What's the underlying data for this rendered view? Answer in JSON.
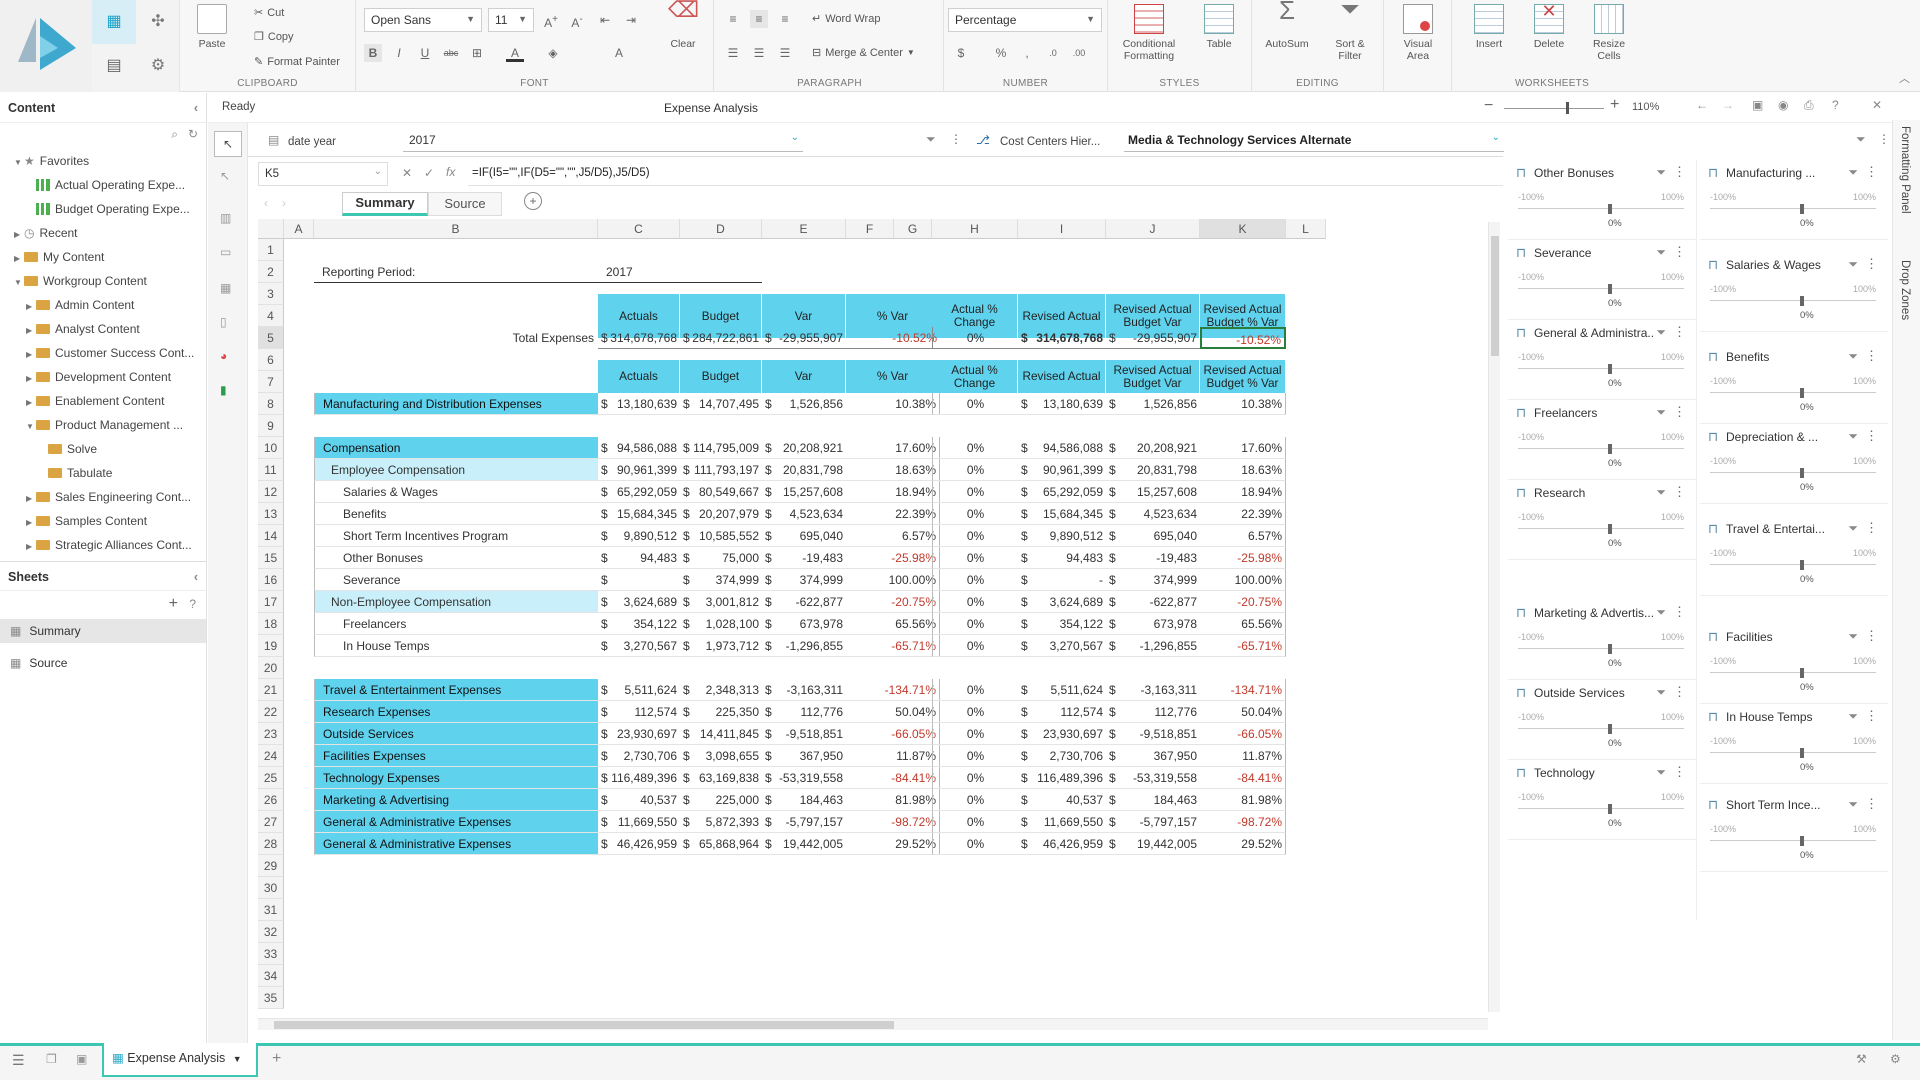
{
  "ribbon": {
    "clipboard": {
      "label": "CLIPBOARD",
      "paste": "Paste",
      "cut": "Cut",
      "copy": "Copy",
      "format_painter": "Format Painter"
    },
    "font": {
      "label": "FONT",
      "family": "Open Sans",
      "size": "11"
    },
    "paragraph": {
      "label": "PARAGRAPH",
      "word_wrap": "Word Wrap",
      "merge_center": "Merge & Center"
    },
    "clear": "Clear",
    "number": {
      "label": "NUMBER",
      "format": "Percentage"
    },
    "styles": {
      "label": "STYLES",
      "conditional": "Conditional\nFormatting",
      "table": "Table"
    },
    "editing": {
      "label": "EDITING",
      "autosum": "AutoSum",
      "sort_filter": "Sort &\nFilter"
    },
    "visual_area": "Visual\nArea",
    "worksheets": {
      "label": "WORKSHEETS",
      "insert": "Insert",
      "delete": "Delete",
      "resize": "Resize\nCells"
    }
  },
  "content_panel": {
    "title": "Content",
    "tree": [
      {
        "label": "Favorites",
        "level": 0,
        "icon": "star"
      },
      {
        "label": "Actual Operating Expe...",
        "level": 1,
        "icon": "chart"
      },
      {
        "label": "Budget Operating Expe...",
        "level": 1,
        "icon": "chart"
      },
      {
        "label": "Recent",
        "level": 0,
        "icon": "clock"
      },
      {
        "label": "My Content",
        "level": 0,
        "icon": "folder"
      },
      {
        "label": "Workgroup Content",
        "level": 0,
        "icon": "folder"
      },
      {
        "label": "Admin Content",
        "level": 1,
        "icon": "folder"
      },
      {
        "label": "Analyst Content",
        "level": 1,
        "icon": "folder"
      },
      {
        "label": "Customer Success Cont...",
        "level": 1,
        "icon": "folder"
      },
      {
        "label": "Development Content",
        "level": 1,
        "icon": "folder"
      },
      {
        "label": "Enablement Content",
        "level": 1,
        "icon": "folder"
      },
      {
        "label": "Product Management ...",
        "level": 1,
        "icon": "folder"
      },
      {
        "label": "Solve",
        "level": 2,
        "icon": "folder"
      },
      {
        "label": "Tabulate",
        "level": 2,
        "icon": "folder"
      },
      {
        "label": "Sales Engineering Cont...",
        "level": 1,
        "icon": "folder"
      },
      {
        "label": "Samples Content",
        "level": 1,
        "icon": "folder"
      },
      {
        "label": "Strategic Alliances Cont...",
        "level": 1,
        "icon": "folder"
      }
    ]
  },
  "sheets_panel": {
    "title": "Sheets",
    "items": [
      "Summary",
      "Source"
    ]
  },
  "status": "Ready",
  "doc_title": "Expense Analysis",
  "zoom": "110%",
  "filters": {
    "date_label": "date year",
    "date_value": "2017",
    "cc_label": "Cost Centers Hier...",
    "cc_value": "Media & Technology Services Alternate"
  },
  "formula": {
    "cell": "K5",
    "text": "=IF(I5=\"\",IF(D5=\"\",\"\",J5/D5),J5/D5)"
  },
  "tabs": [
    "Summary",
    "Source"
  ],
  "columns": [
    "A",
    "B",
    "C",
    "D",
    "E",
    "F",
    "G",
    "H",
    "I",
    "J",
    "K",
    "L"
  ],
  "grid": {
    "reporting_label": "Reporting Period:",
    "reporting_value": "2017",
    "headers_left": [
      "Actuals",
      "Budget",
      "Var",
      "% Var"
    ],
    "headers_right": [
      "Actual % Change",
      "Revised Actual",
      "Revised Actual Budget Var",
      "Revised Actual Budget % Var"
    ],
    "total": {
      "label": "Total Expenses",
      "c": "314,678,768",
      "d": "284,722,861",
      "e": "-29,955,907",
      "f": "-10.52%",
      "h": "0%",
      "i": "314,678,768",
      "j": "-29,955,907",
      "k": "-10.52%"
    },
    "rows": [
      {
        "r": 8,
        "label": "Manufacturing and Distribution Expenses",
        "style": "hl",
        "c": "13,180,639",
        "d": "14,707,495",
        "e": "1,526,856",
        "f": "10.38%",
        "h": "0%",
        "i": "13,180,639",
        "j": "1,526,856",
        "k": "10.38%"
      },
      {
        "r": 10,
        "label": "Compensation",
        "style": "hl",
        "c": "94,586,088",
        "d": "114,795,009",
        "e": "20,208,921",
        "f": "17.60%",
        "h": "0%",
        "i": "94,586,088",
        "j": "20,208,921",
        "k": "17.60%"
      },
      {
        "r": 11,
        "label": "Employee Compensation",
        "style": "hl2",
        "c": "90,961,399",
        "d": "111,793,197",
        "e": "20,831,798",
        "f": "18.63%",
        "h": "0%",
        "i": "90,961,399",
        "j": "20,831,798",
        "k": "18.63%"
      },
      {
        "r": 12,
        "label": "Salaries & Wages",
        "style": "sub",
        "c": "65,292,059",
        "d": "80,549,667",
        "e": "15,257,608",
        "f": "18.94%",
        "h": "0%",
        "i": "65,292,059",
        "j": "15,257,608",
        "k": "18.94%"
      },
      {
        "r": 13,
        "label": "Benefits",
        "style": "sub",
        "c": "15,684,345",
        "d": "20,207,979",
        "e": "4,523,634",
        "f": "22.39%",
        "h": "0%",
        "i": "15,684,345",
        "j": "4,523,634",
        "k": "22.39%"
      },
      {
        "r": 14,
        "label": "Short Term Incentives Program",
        "style": "sub",
        "c": "9,890,512",
        "d": "10,585,552",
        "e": "695,040",
        "f": "6.57%",
        "h": "0%",
        "i": "9,890,512",
        "j": "695,040",
        "k": "6.57%"
      },
      {
        "r": 15,
        "label": "Other Bonuses",
        "style": "sub",
        "c": "94,483",
        "d": "75,000",
        "e": "-19,483",
        "f": "-25.98%",
        "h": "0%",
        "i": "94,483",
        "j": "-19,483",
        "k": "-25.98%"
      },
      {
        "r": 16,
        "label": "Severance",
        "style": "sub",
        "c": "",
        "d": "374,999",
        "e": "374,999",
        "f": "100.00%",
        "h": "0%",
        "i": "-",
        "j": "374,999",
        "k": "100.00%"
      },
      {
        "r": 17,
        "label": "Non-Employee Compensation",
        "style": "hl2",
        "c": "3,624,689",
        "d": "3,001,812",
        "e": "-622,877",
        "f": "-20.75%",
        "h": "0%",
        "i": "3,624,689",
        "j": "-622,877",
        "k": "-20.75%"
      },
      {
        "r": 18,
        "label": "Freelancers",
        "style": "sub",
        "c": "354,122",
        "d": "1,028,100",
        "e": "673,978",
        "f": "65.56%",
        "h": "0%",
        "i": "354,122",
        "j": "673,978",
        "k": "65.56%"
      },
      {
        "r": 19,
        "label": "In House Temps",
        "style": "sub",
        "c": "3,270,567",
        "d": "1,973,712",
        "e": "-1,296,855",
        "f": "-65.71%",
        "h": "0%",
        "i": "3,270,567",
        "j": "-1,296,855",
        "k": "-65.71%"
      },
      {
        "r": 21,
        "label": "Travel & Entertainment Expenses",
        "style": "hl",
        "c": "5,511,624",
        "d": "2,348,313",
        "e": "-3,163,311",
        "f": "-134.71%",
        "h": "0%",
        "i": "5,511,624",
        "j": "-3,163,311",
        "k": "-134.71%"
      },
      {
        "r": 22,
        "label": "Research Expenses",
        "style": "hl",
        "c": "112,574",
        "d": "225,350",
        "e": "112,776",
        "f": "50.04%",
        "h": "0%",
        "i": "112,574",
        "j": "112,776",
        "k": "50.04%"
      },
      {
        "r": 23,
        "label": "Outside Services",
        "style": "hl",
        "c": "23,930,697",
        "d": "14,411,845",
        "e": "-9,518,851",
        "f": "-66.05%",
        "h": "0%",
        "i": "23,930,697",
        "j": "-9,518,851",
        "k": "-66.05%"
      },
      {
        "r": 24,
        "label": "Facilities Expenses",
        "style": "hl",
        "c": "2,730,706",
        "d": "3,098,655",
        "e": "367,950",
        "f": "11.87%",
        "h": "0%",
        "i": "2,730,706",
        "j": "367,950",
        "k": "11.87%"
      },
      {
        "r": 25,
        "label": "Technology Expenses",
        "style": "hl",
        "c": "116,489,396",
        "d": "63,169,838",
        "e": "-53,319,558",
        "f": "-84.41%",
        "h": "0%",
        "i": "116,489,396",
        "j": "-53,319,558",
        "k": "-84.41%"
      },
      {
        "r": 26,
        "label": "Marketing & Advertising",
        "style": "hl",
        "c": "40,537",
        "d": "225,000",
        "e": "184,463",
        "f": "81.98%",
        "h": "0%",
        "i": "40,537",
        "j": "184,463",
        "k": "81.98%"
      },
      {
        "r": 27,
        "label": "General & Administrative Expenses",
        "style": "hl",
        "c": "11,669,550",
        "d": "5,872,393",
        "e": "-5,797,157",
        "f": "-98.72%",
        "h": "0%",
        "i": "11,669,550",
        "j": "-5,797,157",
        "k": "-98.72%"
      },
      {
        "r": 28,
        "label": "General & Administrative Expenses",
        "style": "hl",
        "c": "46,426,959",
        "d": "65,868,964",
        "e": "19,442,005",
        "f": "29.52%",
        "h": "0%",
        "i": "46,426,959",
        "j": "19,442,005",
        "k": "29.52%"
      }
    ]
  },
  "slicers": {
    "low": "-100%",
    "high": "100%",
    "value": "0%",
    "left": [
      "Other Bonuses",
      "Severance",
      "General & Administra...",
      "Freelancers",
      "Research",
      "Marketing & Advertis...",
      "Outside Services",
      "Technology"
    ],
    "right": [
      "Manufacturing ...",
      "Salaries & Wages",
      "Benefits",
      "Depreciation & ...",
      "Travel & Entertai...",
      "Facilities",
      "In House Temps",
      "Short Term Ince..."
    ]
  },
  "vertical_tabs": [
    "Formatting Panel",
    "Drop Zones"
  ],
  "bottom": {
    "tab": "Expense Analysis"
  },
  "colors": {
    "accent": "#5fd3ee",
    "accent_light": "#c9f0fa",
    "teal": "#3cc7b3",
    "negative": "#c0392b"
  }
}
